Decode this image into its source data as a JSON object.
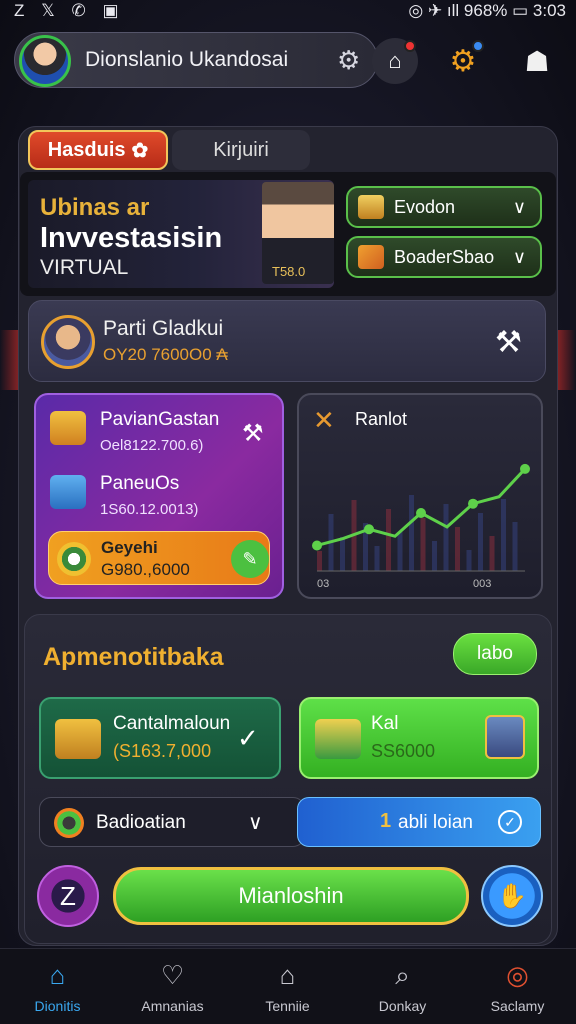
{
  "statusbar": {
    "left_icons": "Z 𝕏 ✆ ▣",
    "right_text": "◎ ✈ ıll 968% ▭ 3:03"
  },
  "header": {
    "profile_name": "Dionslanio Ukandosai"
  },
  "tabs": [
    {
      "label": "Hasduis"
    },
    {
      "label": "Kirjuiri"
    }
  ],
  "hero": {
    "line1": "Ubinas ar",
    "line2": "Invvestasisin",
    "line3": "VIRTUAL",
    "person_value": "T58.0",
    "buttons": [
      {
        "label": "Evodon"
      },
      {
        "label": "BoaderSbao"
      }
    ]
  },
  "profile_card": {
    "name": "Parti Gladkui",
    "value": "OY20 7600O0 ₳"
  },
  "wallet": {
    "items": [
      {
        "name": "PavianGastan",
        "value": "Oel8122.700.6)"
      },
      {
        "name": "PaneuOs",
        "value": "1S60.12.0013)"
      }
    ],
    "highlight": {
      "title": "Geyehi",
      "value": "G980.,6000"
    }
  },
  "chart_card": {
    "title": "Ranlot"
  },
  "chart_data": {
    "type": "line",
    "title": "Ranlot",
    "x": [
      "03",
      "",
      "",
      "",
      "",
      "",
      "",
      "",
      "003"
    ],
    "values": [
      22,
      28,
      36,
      30,
      50,
      38,
      58,
      64,
      88
    ],
    "xlabel": "",
    "ylabel": "",
    "x_tick_labels": [
      "03",
      "003"
    ],
    "color": "#5ed04a"
  },
  "section": {
    "title": "Apmenotitbaka",
    "labo_button": "labo",
    "cards": [
      {
        "name": "Cantalmaloun",
        "value": "(S163.7,000"
      },
      {
        "name": "Kal",
        "value": "SS6000"
      }
    ],
    "select_dark": "Badioatian",
    "select_blue": "abli loian",
    "select_blue_prefix": "1",
    "main_button": "Mianloshin"
  },
  "bottom_nav": [
    {
      "label": "Dionitis",
      "icon": "home-icon"
    },
    {
      "label": "Amnanias",
      "icon": "heart-circle-icon"
    },
    {
      "label": "Tenniie",
      "icon": "house-outline-icon"
    },
    {
      "label": "Donkay",
      "icon": "search-icon"
    },
    {
      "label": "Saclamy",
      "icon": "target-icon"
    }
  ],
  "colors": {
    "accent_green": "#4cc040",
    "accent_gold": "#f0b030",
    "accent_blue": "#3aa8f0",
    "accent_purple": "#8a2aa0"
  }
}
